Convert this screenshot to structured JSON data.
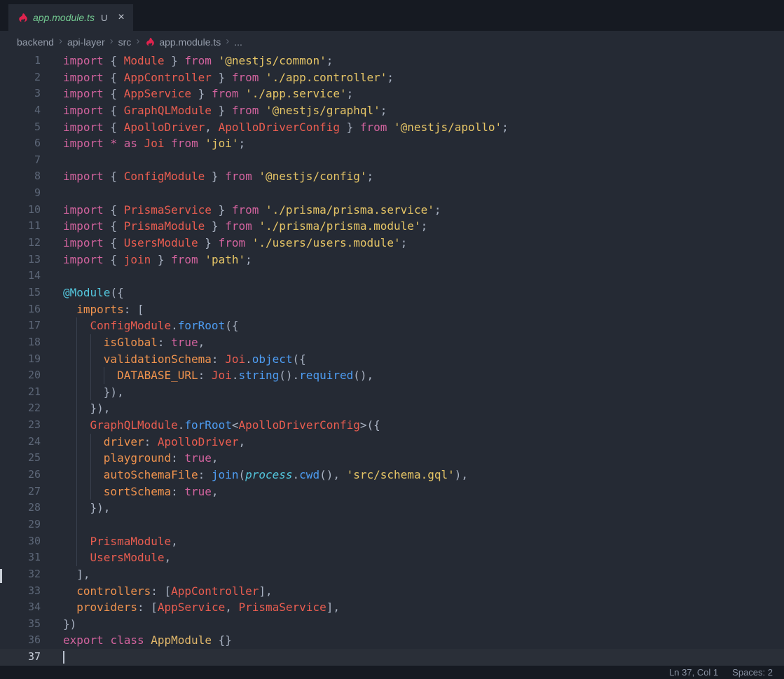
{
  "theme": {
    "bg": "#252a34",
    "tab_bar": "#161a22",
    "status_bar": "#161a22",
    "gutter": "#5d6778",
    "gutter_active": "#cdd3de",
    "guide": "#39404e",
    "text": "#c8cfdb",
    "punctuation": "#a9b2c2",
    "keyword": "#d2639e",
    "identifier": "#ea5d50",
    "property": "#f0934e",
    "string": "#e6c566",
    "function": "#4e9df3",
    "decorator": "#53c6dd",
    "builtin": "#53c6dd",
    "class_name": "#e2b86b",
    "tab_label": "#73c991",
    "git_badge": "#b7bec9",
    "breadcrumb": "#959dab",
    "nest_red": "#e0234e",
    "status_text": "#8b94a5"
  },
  "tab": {
    "label": "app.module.ts",
    "git_status": "U",
    "close_glyph": "×",
    "icon": "nestjs-icon"
  },
  "breadcrumb": {
    "separator": "›",
    "items": [
      {
        "label": "backend"
      },
      {
        "label": "api-layer"
      },
      {
        "label": "src"
      },
      {
        "label": "app.module.ts",
        "icon": "nestjs-icon"
      },
      {
        "label": "..."
      }
    ]
  },
  "status_bar": {
    "cursor_position": "Ln 37, Col 1",
    "indentation": "Spaces: 2"
  },
  "code": {
    "language": "typescript",
    "lines": [
      {
        "n": 1,
        "i": 0,
        "t": [
          [
            "kw",
            "import"
          ],
          [
            "pun",
            " { "
          ],
          [
            "id",
            "Module"
          ],
          [
            "pun",
            " } "
          ],
          [
            "kw",
            "from"
          ],
          [
            "pln",
            " "
          ],
          [
            "str",
            "'@nestjs/common'"
          ],
          [
            "pun",
            ";"
          ]
        ]
      },
      {
        "n": 2,
        "i": 0,
        "t": [
          [
            "kw",
            "import"
          ],
          [
            "pun",
            " { "
          ],
          [
            "id",
            "AppController"
          ],
          [
            "pun",
            " } "
          ],
          [
            "kw",
            "from"
          ],
          [
            "pln",
            " "
          ],
          [
            "str",
            "'./app.controller'"
          ],
          [
            "pun",
            ";"
          ]
        ]
      },
      {
        "n": 3,
        "i": 0,
        "t": [
          [
            "kw",
            "import"
          ],
          [
            "pun",
            " { "
          ],
          [
            "id",
            "AppService"
          ],
          [
            "pun",
            " } "
          ],
          [
            "kw",
            "from"
          ],
          [
            "pln",
            " "
          ],
          [
            "str",
            "'./app.service'"
          ],
          [
            "pun",
            ";"
          ]
        ]
      },
      {
        "n": 4,
        "i": 0,
        "t": [
          [
            "kw",
            "import"
          ],
          [
            "pun",
            " { "
          ],
          [
            "id",
            "GraphQLModule"
          ],
          [
            "pun",
            " } "
          ],
          [
            "kw",
            "from"
          ],
          [
            "pln",
            " "
          ],
          [
            "str",
            "'@nestjs/graphql'"
          ],
          [
            "pun",
            ";"
          ]
        ]
      },
      {
        "n": 5,
        "i": 0,
        "t": [
          [
            "kw",
            "import"
          ],
          [
            "pun",
            " { "
          ],
          [
            "id",
            "ApolloDriver"
          ],
          [
            "pun",
            ", "
          ],
          [
            "id",
            "ApolloDriverConfig"
          ],
          [
            "pun",
            " } "
          ],
          [
            "kw",
            "from"
          ],
          [
            "pln",
            " "
          ],
          [
            "str",
            "'@nestjs/apollo'"
          ],
          [
            "pun",
            ";"
          ]
        ]
      },
      {
        "n": 6,
        "i": 0,
        "t": [
          [
            "kw",
            "import"
          ],
          [
            "pln",
            " "
          ],
          [
            "kw",
            "*"
          ],
          [
            "pln",
            " "
          ],
          [
            "kw",
            "as"
          ],
          [
            "pln",
            " "
          ],
          [
            "id",
            "Joi"
          ],
          [
            "pln",
            " "
          ],
          [
            "kw",
            "from"
          ],
          [
            "pln",
            " "
          ],
          [
            "str",
            "'joi'"
          ],
          [
            "pun",
            ";"
          ]
        ]
      },
      {
        "n": 7,
        "i": 0,
        "t": []
      },
      {
        "n": 8,
        "i": 0,
        "t": [
          [
            "kw",
            "import"
          ],
          [
            "pun",
            " { "
          ],
          [
            "id",
            "ConfigModule"
          ],
          [
            "pun",
            " } "
          ],
          [
            "kw",
            "from"
          ],
          [
            "pln",
            " "
          ],
          [
            "str",
            "'@nestjs/config'"
          ],
          [
            "pun",
            ";"
          ]
        ]
      },
      {
        "n": 9,
        "i": 0,
        "t": []
      },
      {
        "n": 10,
        "i": 0,
        "t": [
          [
            "kw",
            "import"
          ],
          [
            "pun",
            " { "
          ],
          [
            "id",
            "PrismaService"
          ],
          [
            "pun",
            " } "
          ],
          [
            "kw",
            "from"
          ],
          [
            "pln",
            " "
          ],
          [
            "str",
            "'./prisma/prisma.service'"
          ],
          [
            "pun",
            ";"
          ]
        ]
      },
      {
        "n": 11,
        "i": 0,
        "t": [
          [
            "kw",
            "import"
          ],
          [
            "pun",
            " { "
          ],
          [
            "id",
            "PrismaModule"
          ],
          [
            "pun",
            " } "
          ],
          [
            "kw",
            "from"
          ],
          [
            "pln",
            " "
          ],
          [
            "str",
            "'./prisma/prisma.module'"
          ],
          [
            "pun",
            ";"
          ]
        ]
      },
      {
        "n": 12,
        "i": 0,
        "t": [
          [
            "kw",
            "import"
          ],
          [
            "pun",
            " { "
          ],
          [
            "id",
            "UsersModule"
          ],
          [
            "pun",
            " } "
          ],
          [
            "kw",
            "from"
          ],
          [
            "pln",
            " "
          ],
          [
            "str",
            "'./users/users.module'"
          ],
          [
            "pun",
            ";"
          ]
        ]
      },
      {
        "n": 13,
        "i": 0,
        "t": [
          [
            "kw",
            "import"
          ],
          [
            "pun",
            " { "
          ],
          [
            "id",
            "join"
          ],
          [
            "pun",
            " } "
          ],
          [
            "kw",
            "from"
          ],
          [
            "pln",
            " "
          ],
          [
            "str",
            "'path'"
          ],
          [
            "pun",
            ";"
          ]
        ]
      },
      {
        "n": 14,
        "i": 0,
        "t": []
      },
      {
        "n": 15,
        "i": 0,
        "t": [
          [
            "dec",
            "@Module"
          ],
          [
            "pun",
            "({"
          ]
        ]
      },
      {
        "n": 16,
        "i": 2,
        "t": [
          [
            "prop",
            "imports"
          ],
          [
            "pun",
            ": ["
          ]
        ]
      },
      {
        "n": 17,
        "i": 4,
        "t": [
          [
            "id",
            "ConfigModule"
          ],
          [
            "pun",
            "."
          ],
          [
            "fn",
            "forRoot"
          ],
          [
            "pun",
            "({"
          ]
        ]
      },
      {
        "n": 18,
        "i": 6,
        "t": [
          [
            "prop",
            "isGlobal"
          ],
          [
            "pun",
            ": "
          ],
          [
            "kw",
            "true"
          ],
          [
            "pun",
            ","
          ]
        ]
      },
      {
        "n": 19,
        "i": 6,
        "t": [
          [
            "prop",
            "validationSchema"
          ],
          [
            "pun",
            ": "
          ],
          [
            "id",
            "Joi"
          ],
          [
            "pun",
            "."
          ],
          [
            "fn",
            "object"
          ],
          [
            "pun",
            "({"
          ]
        ]
      },
      {
        "n": 20,
        "i": 8,
        "t": [
          [
            "prop",
            "DATABASE_URL"
          ],
          [
            "pun",
            ": "
          ],
          [
            "id",
            "Joi"
          ],
          [
            "pun",
            "."
          ],
          [
            "fn",
            "string"
          ],
          [
            "pun",
            "()."
          ],
          [
            "fn",
            "required"
          ],
          [
            "pun",
            "(),"
          ]
        ]
      },
      {
        "n": 21,
        "i": 6,
        "t": [
          [
            "pun",
            "}),"
          ]
        ]
      },
      {
        "n": 22,
        "i": 4,
        "t": [
          [
            "pun",
            "}),"
          ]
        ]
      },
      {
        "n": 23,
        "i": 4,
        "t": [
          [
            "id",
            "GraphQLModule"
          ],
          [
            "pun",
            "."
          ],
          [
            "fn",
            "forRoot"
          ],
          [
            "pun",
            "<"
          ],
          [
            "id",
            "ApolloDriverConfig"
          ],
          [
            "pun",
            ">({"
          ]
        ]
      },
      {
        "n": 24,
        "i": 6,
        "t": [
          [
            "prop",
            "driver"
          ],
          [
            "pun",
            ": "
          ],
          [
            "id",
            "ApolloDriver"
          ],
          [
            "pun",
            ","
          ]
        ]
      },
      {
        "n": 25,
        "i": 6,
        "t": [
          [
            "prop",
            "playground"
          ],
          [
            "pun",
            ": "
          ],
          [
            "kw",
            "true"
          ],
          [
            "pun",
            ","
          ]
        ]
      },
      {
        "n": 26,
        "i": 6,
        "t": [
          [
            "prop",
            "autoSchemaFile"
          ],
          [
            "pun",
            ": "
          ],
          [
            "fn",
            "join"
          ],
          [
            "pun",
            "("
          ],
          [
            "bi",
            "process"
          ],
          [
            "pun",
            "."
          ],
          [
            "fn",
            "cwd"
          ],
          [
            "pun",
            "(), "
          ],
          [
            "str",
            "'src/schema.gql'"
          ],
          [
            "pun",
            "),"
          ]
        ]
      },
      {
        "n": 27,
        "i": 6,
        "t": [
          [
            "prop",
            "sortSchema"
          ],
          [
            "pun",
            ": "
          ],
          [
            "kw",
            "true"
          ],
          [
            "pun",
            ","
          ]
        ]
      },
      {
        "n": 28,
        "i": 4,
        "t": [
          [
            "pun",
            "}),"
          ]
        ]
      },
      {
        "n": 29,
        "i": 4,
        "t": []
      },
      {
        "n": 30,
        "i": 4,
        "t": [
          [
            "id",
            "PrismaModule"
          ],
          [
            "pun",
            ","
          ]
        ]
      },
      {
        "n": 31,
        "i": 4,
        "t": [
          [
            "id",
            "UsersModule"
          ],
          [
            "pun",
            ","
          ]
        ]
      },
      {
        "n": 32,
        "i": 2,
        "t": [
          [
            "pun",
            "],"
          ]
        ]
      },
      {
        "n": 33,
        "i": 2,
        "t": [
          [
            "prop",
            "controllers"
          ],
          [
            "pun",
            ": ["
          ],
          [
            "id",
            "AppController"
          ],
          [
            "pun",
            "],"
          ]
        ]
      },
      {
        "n": 34,
        "i": 2,
        "t": [
          [
            "prop",
            "providers"
          ],
          [
            "pun",
            ": ["
          ],
          [
            "id",
            "AppService"
          ],
          [
            "pun",
            ", "
          ],
          [
            "id",
            "PrismaService"
          ],
          [
            "pun",
            "],"
          ]
        ]
      },
      {
        "n": 35,
        "i": 0,
        "t": [
          [
            "pun",
            "})"
          ]
        ]
      },
      {
        "n": 36,
        "i": 0,
        "t": [
          [
            "kw",
            "export"
          ],
          [
            "pln",
            " "
          ],
          [
            "kw",
            "class"
          ],
          [
            "pln",
            " "
          ],
          [
            "cls",
            "AppModule"
          ],
          [
            "pun",
            " {}"
          ]
        ]
      },
      {
        "n": 37,
        "i": 0,
        "t": [],
        "c": true
      }
    ]
  }
}
